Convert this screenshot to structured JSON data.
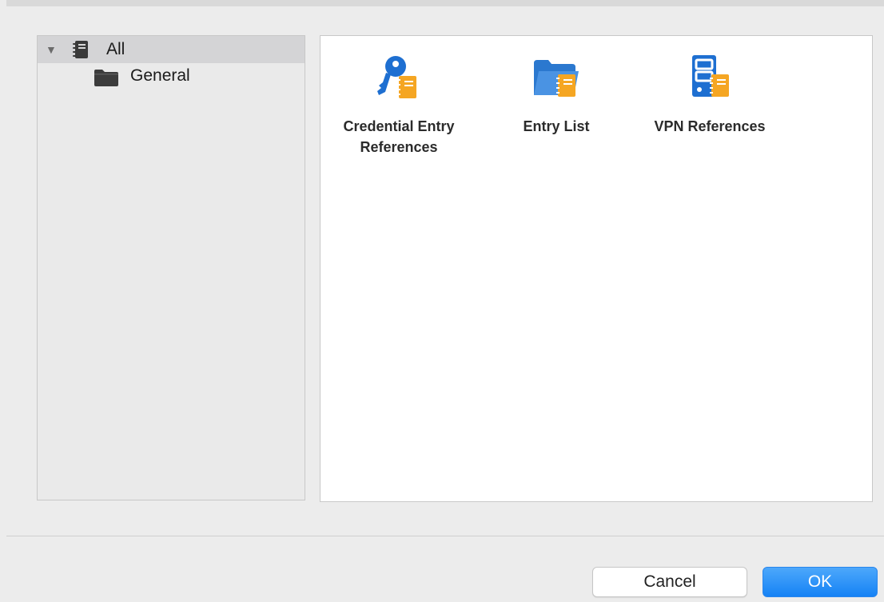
{
  "tree": {
    "root": {
      "label": "All",
      "expanded": true,
      "selected": true,
      "icon": "vault-icon"
    },
    "children": [
      {
        "label": "General",
        "icon": "folder-icon"
      }
    ]
  },
  "items": [
    {
      "label_line1": "Credential Entry",
      "label_line2": "References",
      "icon": "key-document-icon"
    },
    {
      "label_line1": "Entry List",
      "label_line2": "",
      "icon": "folder-document-icon"
    },
    {
      "label_line1": "VPN References",
      "label_line2": "",
      "icon": "server-document-icon"
    }
  ],
  "buttons": {
    "cancel": "Cancel",
    "ok": "OK"
  },
  "colors": {
    "icon_blue": "#1e6fd1",
    "icon_orange": "#f5a623",
    "ok_blue": "#1582f5"
  }
}
